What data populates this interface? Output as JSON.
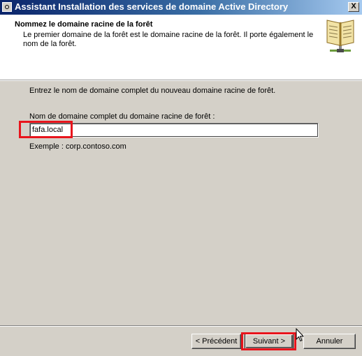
{
  "window": {
    "title": "Assistant Installation des services de domaine Active Directory",
    "close_label": "X"
  },
  "header": {
    "title": "Nommez le domaine racine de la forêt",
    "description": "Le premier domaine de la forêt est le domaine racine de la forêt. Il porte également le nom de la forêt.",
    "icon": "book-icon"
  },
  "body": {
    "instruction": "Entrez le nom de domaine complet du nouveau domaine racine de forêt.",
    "field_label": "Nom de domaine complet du domaine racine de forêt :",
    "field_value": "fafa.local",
    "example": "Exemple : corp.contoso.com"
  },
  "buttons": {
    "previous": "< Précédent",
    "next": "Suivant >",
    "cancel": "Annuler"
  },
  "colors": {
    "highlight": "#e8141c",
    "titlebar_start": "#0a246a",
    "titlebar_end": "#a6caf0",
    "dialog_background": "#d4d0c8"
  }
}
